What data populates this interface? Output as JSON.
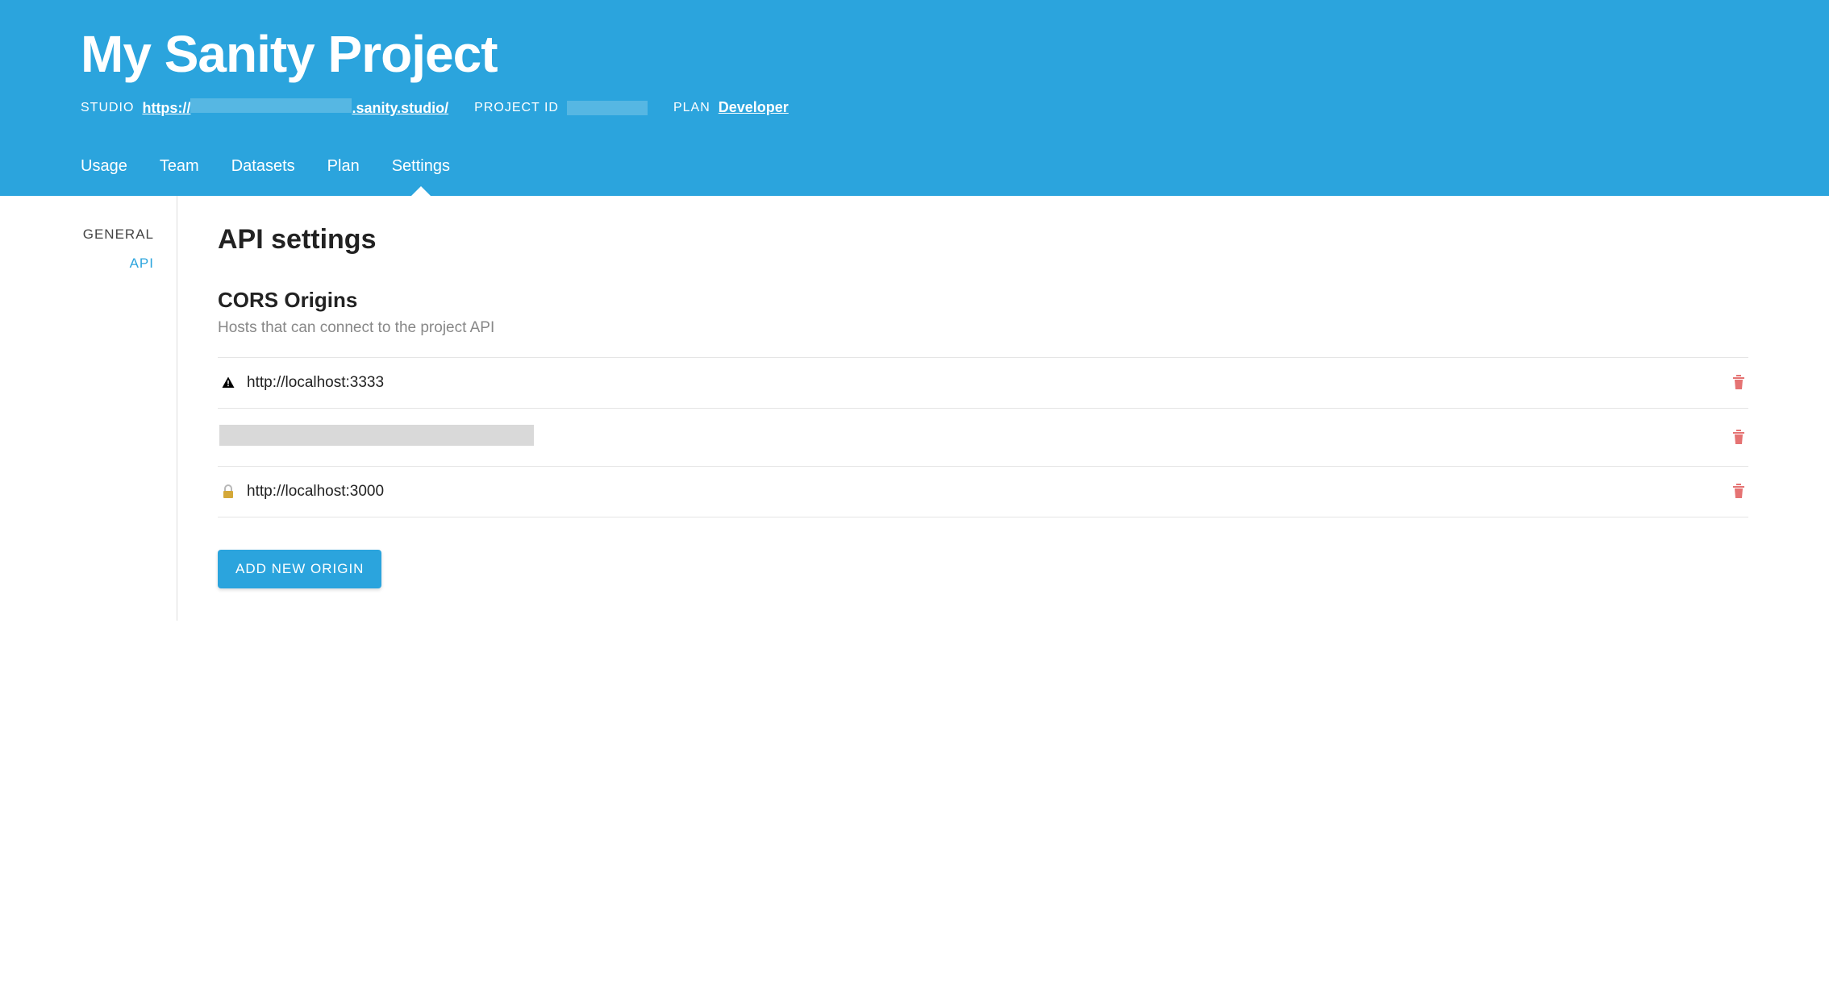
{
  "header": {
    "title": "My Sanity Project",
    "studio_label": "STUDIO",
    "studio_url_prefix": "https://",
    "studio_url_suffix": ".sanity.studio/",
    "project_id_label": "PROJECT ID",
    "plan_label": "PLAN",
    "plan_value": "Developer"
  },
  "tabs": [
    {
      "label": "Usage",
      "active": false
    },
    {
      "label": "Team",
      "active": false
    },
    {
      "label": "Datasets",
      "active": false
    },
    {
      "label": "Plan",
      "active": false
    },
    {
      "label": "Settings",
      "active": true
    }
  ],
  "sidebar": {
    "items": [
      {
        "label": "GENERAL",
        "active": false
      },
      {
        "label": "API",
        "active": true
      }
    ]
  },
  "main": {
    "page_title": "API settings",
    "cors": {
      "title": "CORS Origins",
      "description": "Hosts that can connect to the project API",
      "origins": [
        {
          "icon": "warning",
          "url": "http://localhost:3333"
        },
        {
          "icon": "redacted",
          "url": ""
        },
        {
          "icon": "lock",
          "url": "http://localhost:3000"
        }
      ],
      "add_button": "ADD NEW ORIGIN"
    }
  }
}
